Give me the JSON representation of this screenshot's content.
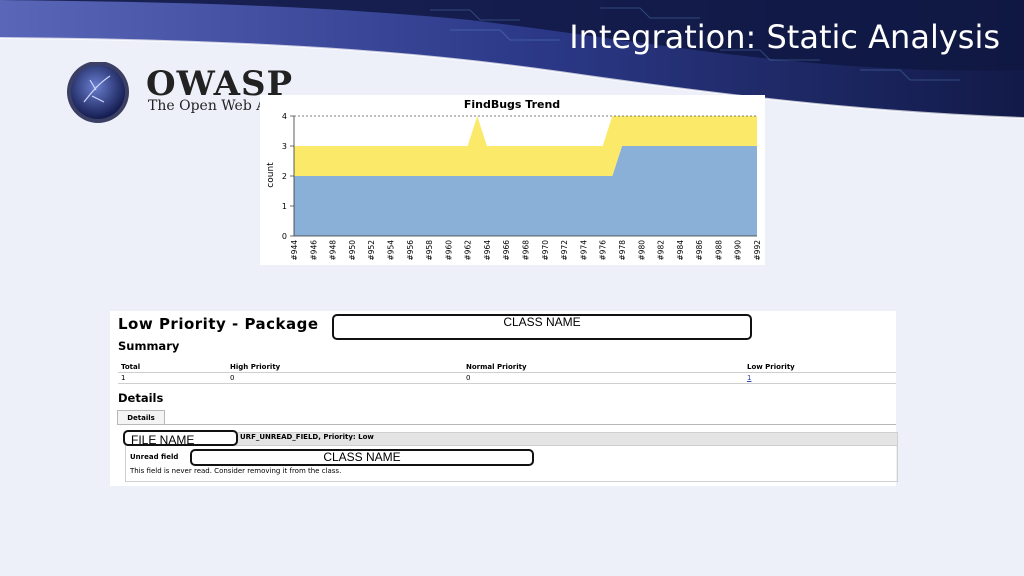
{
  "slide": {
    "title": "Integration: Static Analysis",
    "colors": {
      "banner_dark": "#16204f",
      "banner_mid": "#2f3b8f",
      "background": "#eef0f9"
    }
  },
  "logo": {
    "name": "OWASP",
    "tagline": "The Open Web A"
  },
  "chart_data": {
    "type": "area",
    "title": "FindBugs Trend",
    "ylabel": "count",
    "xlabel": "",
    "ylim": [
      0,
      4
    ],
    "yticks": [
      "0",
      "1",
      "2",
      "3",
      "4"
    ],
    "x": [
      "#944",
      "#945",
      "#946",
      "#947",
      "#948",
      "#949",
      "#950",
      "#951",
      "#952",
      "#953",
      "#954",
      "#955",
      "#956",
      "#957",
      "#958",
      "#959",
      "#960",
      "#961",
      "#962",
      "#963",
      "#964",
      "#965",
      "#966",
      "#967",
      "#968",
      "#969",
      "#970",
      "#971",
      "#972",
      "#973",
      "#974",
      "#975",
      "#976",
      "#977",
      "#978",
      "#979",
      "#980",
      "#981",
      "#982",
      "#983",
      "#984",
      "#985",
      "#986",
      "#987",
      "#988",
      "#989",
      "#990",
      "#991",
      "#992"
    ],
    "tick_labels": [
      "#944",
      "#946",
      "#948",
      "#950",
      "#952",
      "#954",
      "#956",
      "#958",
      "#960",
      "#962",
      "#964",
      "#966",
      "#968",
      "#970",
      "#972",
      "#974",
      "#976",
      "#978",
      "#980",
      "#982",
      "#984",
      "#986",
      "#988",
      "#990",
      "#992"
    ],
    "series": [
      {
        "values": [
          2,
          2,
          2,
          2,
          2,
          2,
          2,
          2,
          2,
          2,
          2,
          2,
          2,
          2,
          2,
          2,
          2,
          2,
          2,
          2,
          2,
          2,
          2,
          2,
          2,
          2,
          2,
          2,
          2,
          2,
          2,
          2,
          2,
          2,
          3,
          3,
          3,
          3,
          3,
          3,
          3,
          3,
          3,
          3,
          3,
          3,
          3,
          3,
          3
        ],
        "color": "#8bb0d8"
      },
      {
        "values": [
          1,
          1,
          1,
          1,
          1,
          1,
          1,
          1,
          1,
          1,
          1,
          1,
          1,
          1,
          1,
          1,
          1,
          1,
          1,
          2,
          1,
          1,
          1,
          1,
          1,
          1,
          1,
          1,
          1,
          1,
          1,
          1,
          1,
          2,
          1,
          1,
          1,
          1,
          1,
          1,
          1,
          1,
          1,
          1,
          1,
          1,
          1,
          1,
          1
        ],
        "color": "#fbe96a"
      }
    ],
    "grid": "dashed line at 4"
  },
  "report": {
    "title": "Low Priority - Package",
    "summary_heading": "Summary",
    "columns": [
      "Total",
      "High Priority",
      "Normal Priority",
      "Low Priority"
    ],
    "row": [
      "1",
      "0",
      "0",
      "1"
    ],
    "details_heading": "Details",
    "tab_label": "Details",
    "bug_header": "URF_UNREAD_FIELD, Priority: Low",
    "bug_title_prefix": "Unread field",
    "bug_description": "This field is never read.  Consider removing it from the class.",
    "redactions": {
      "class_name_1": "CLASS NAME",
      "file_name": "FILE NAME",
      "class_name_2": "CLASS NAME"
    }
  }
}
